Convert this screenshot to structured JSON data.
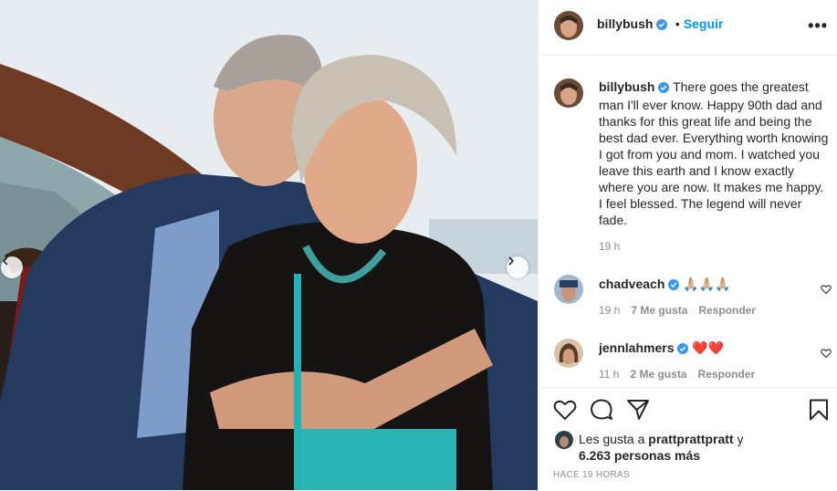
{
  "post": {
    "author": "billybush",
    "follow_label": "Seguir",
    "more_label": "•••",
    "caption_author": "billybush",
    "caption_text": "There goes the greatest man I'll ever know. Happy 90th dad and thanks for this great life and being the best dad ever. Everything worth knowing I got from you and mom. I watched you leave this earth and I know exactly where you are now. It makes me happy. I feel blessed. The legend will never fade.",
    "caption_time": "19 h"
  },
  "comments": [
    {
      "author": "chadveach",
      "text": "🙏🏼🙏🏼🙏🏼",
      "time": "19 h",
      "likes": "7 Me gusta",
      "reply": "Responder"
    },
    {
      "author": "jennlahmers",
      "text": "❤️❤️",
      "time": "11 h",
      "likes": "2 Me gusta",
      "reply": "Responder"
    }
  ],
  "likes": {
    "prefix": "Les gusta a",
    "user": "prattprattpratt",
    "conj": "y",
    "count": "6.263 personas más"
  },
  "timestamp": "HACE 19 HORAS",
  "icons": [
    "heart-icon",
    "comment-icon",
    "share-icon",
    "bookmark-icon",
    "verified-icon",
    "chevron-left-icon",
    "chevron-right-icon"
  ],
  "colors": {
    "accent": "#0095f6",
    "text": "#262626",
    "muted": "#8e8e8e",
    "heart": "#ed4956"
  }
}
